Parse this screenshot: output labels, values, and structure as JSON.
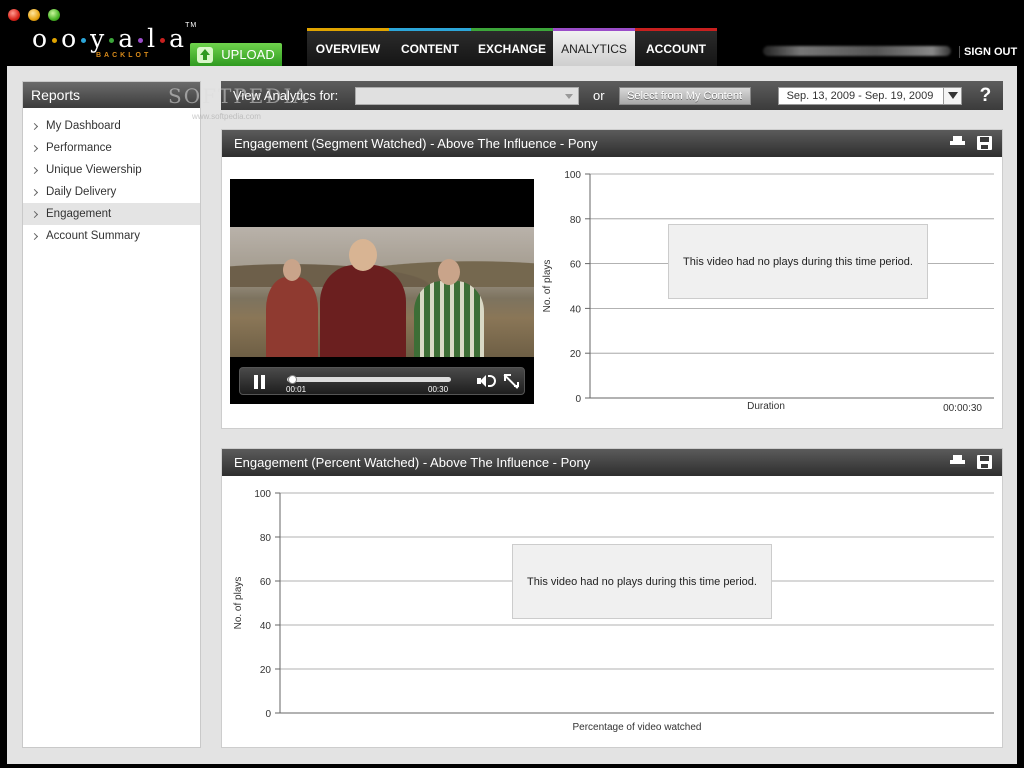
{
  "window": {
    "brand": {
      "letters": [
        "o",
        "o",
        "y",
        "a",
        "l",
        "a"
      ],
      "tm": "TM",
      "sub": "BACKLOT"
    },
    "upload_label": "UPLOAD",
    "tabs": [
      {
        "label": "OVERVIEW",
        "color": "#e0a400",
        "active": false
      },
      {
        "label": "CONTENT",
        "color": "#2ca6d9",
        "active": false
      },
      {
        "label": "EXCHANGE",
        "color": "#3ca63a",
        "active": false
      },
      {
        "label": "ANALYTICS",
        "color": "#9b4dc9",
        "active": true
      },
      {
        "label": "ACCOUNT",
        "color": "#c8201f",
        "active": false
      }
    ],
    "sign_out": "SIGN OUT"
  },
  "watermark": {
    "main": "SOFTPEDIA",
    "small": "www.softpedia.com"
  },
  "sidebar": {
    "title": "Reports",
    "items": [
      {
        "label": "My Dashboard",
        "active": false
      },
      {
        "label": "Performance",
        "active": false
      },
      {
        "label": "Unique Viewership",
        "active": false
      },
      {
        "label": "Daily Delivery",
        "active": false
      },
      {
        "label": "Engagement",
        "active": true
      },
      {
        "label": "Account Summary",
        "active": false
      }
    ]
  },
  "filter": {
    "label": "View Analytics for:",
    "selected": "",
    "or": "or",
    "select_content": "Select from My Content",
    "date_range": "Sep. 13, 2009 - Sep. 19, 2009",
    "help": "?"
  },
  "panel1": {
    "title": "Engagement (Segment Watched) - Above The Influence - Pony",
    "player": {
      "current_time": "00:01",
      "duration": "00:30",
      "progress": 0.03
    }
  },
  "panel2": {
    "title": "Engagement (Percent Watched) - Above The Influence - Pony"
  },
  "chart_data": [
    {
      "type": "bar",
      "ylabel": "No. of plays",
      "xlabel": "Duration",
      "x_end_label": "00:00:30",
      "ylim": [
        0,
        100
      ],
      "yticks": [
        0,
        20,
        40,
        60,
        80,
        100
      ],
      "grid": true,
      "series": [],
      "message": "This video had no plays during this time period."
    },
    {
      "type": "bar",
      "ylabel": "No. of plays",
      "xlabel": "Percentage of video watched",
      "ylim": [
        0,
        100
      ],
      "yticks": [
        0,
        20,
        40,
        60,
        80,
        100
      ],
      "grid": true,
      "series": [],
      "message": "This video had no plays during this time period."
    }
  ]
}
